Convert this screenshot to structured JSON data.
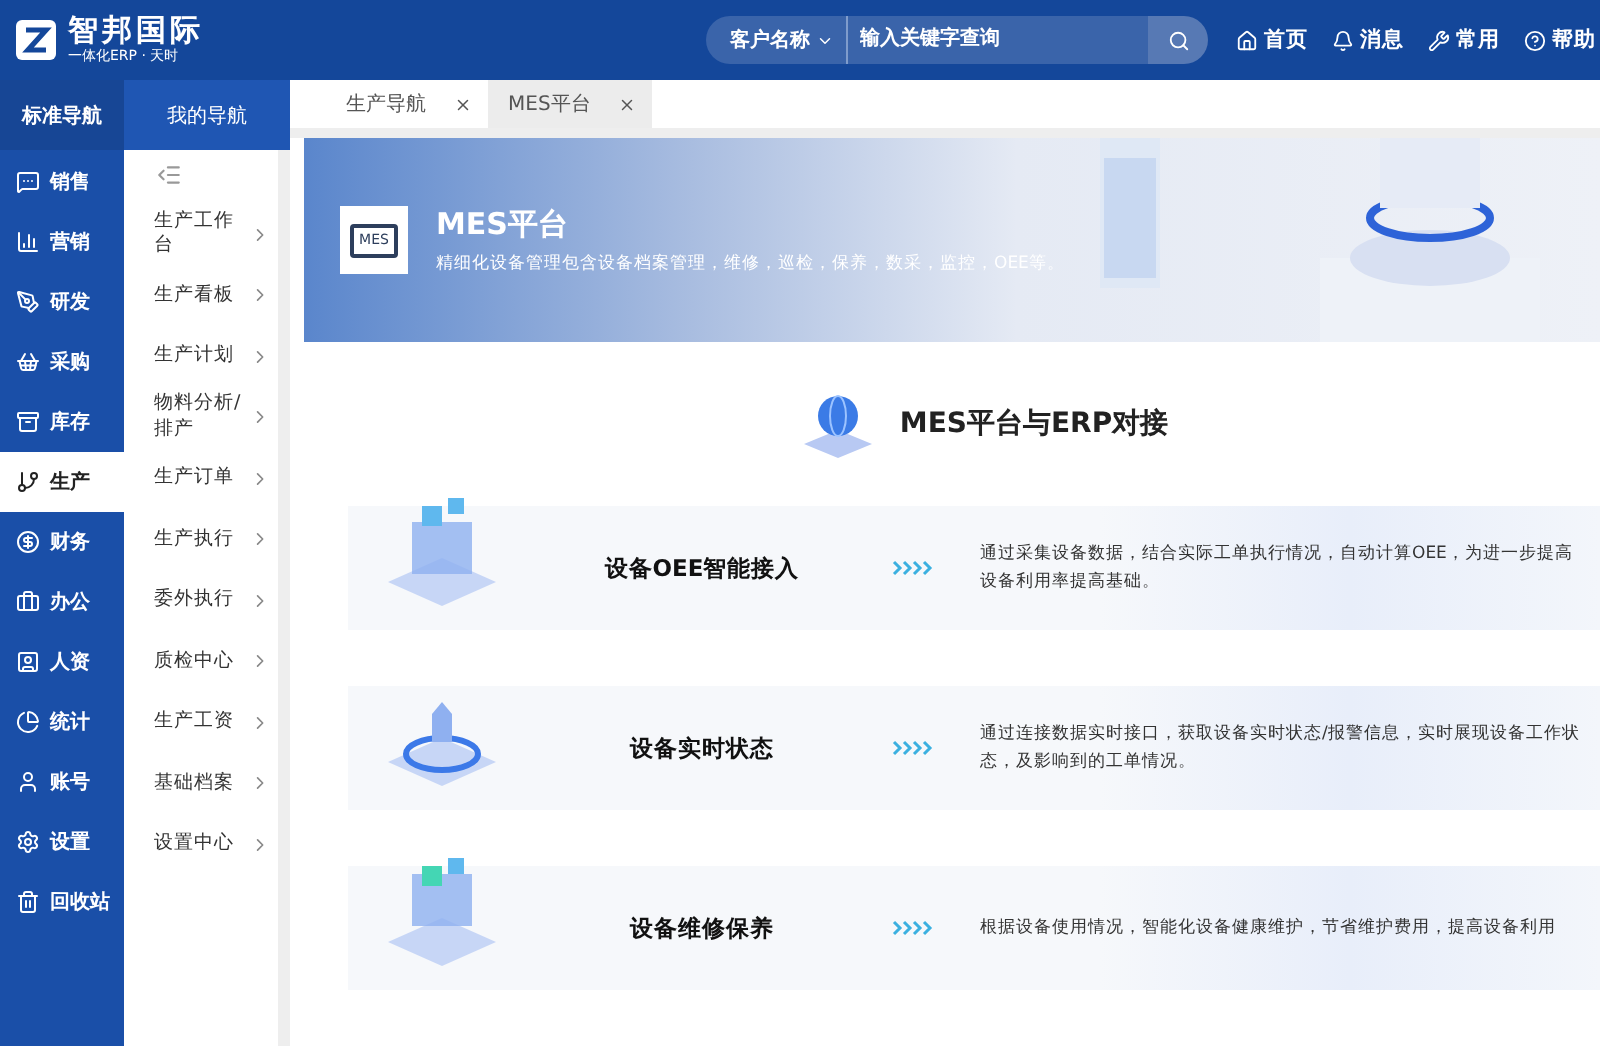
{
  "header": {
    "logo": {
      "name": "智邦国际",
      "slogan": "一体化ERP · 天时"
    },
    "search": {
      "scope": "客户名称",
      "placeholder": "输入关键字查询"
    },
    "links": [
      {
        "label": "首页"
      },
      {
        "label": "消息"
      },
      {
        "label": "常用"
      },
      {
        "label": "帮助"
      }
    ]
  },
  "nav_tabs": [
    {
      "label": "标准导航",
      "selected": true
    },
    {
      "label": "我的导航",
      "selected": false
    }
  ],
  "modules": [
    {
      "label": "销售",
      "selected": false
    },
    {
      "label": "营销",
      "selected": false
    },
    {
      "label": "研发",
      "selected": false
    },
    {
      "label": "采购",
      "selected": false
    },
    {
      "label": "库存",
      "selected": false
    },
    {
      "label": "生产",
      "selected": true
    },
    {
      "label": "财务",
      "selected": false
    },
    {
      "label": "办公",
      "selected": false
    },
    {
      "label": "人资",
      "selected": false
    },
    {
      "label": "统计",
      "selected": false
    },
    {
      "label": "账号",
      "selected": false
    },
    {
      "label": "设置",
      "selected": false
    },
    {
      "label": "回收站",
      "selected": false
    }
  ],
  "submenu": [
    {
      "label": "生产工作台"
    },
    {
      "label": "生产看板"
    },
    {
      "label": "生产计划"
    },
    {
      "label": "物料分析/排产"
    },
    {
      "label": "生产订单"
    },
    {
      "label": "生产执行"
    },
    {
      "label": "委外执行"
    },
    {
      "label": "质检中心"
    },
    {
      "label": "生产工资"
    },
    {
      "label": "基础档案"
    },
    {
      "label": "设置中心"
    }
  ],
  "page_tabs": [
    {
      "label": "生产导航",
      "selected": false
    },
    {
      "label": "MES平台",
      "selected": true
    }
  ],
  "banner": {
    "icon_label": "MES",
    "title": "MES平台",
    "description": "精细化设备管理包含设备档案管理，维修，巡检，保养，数采，监控，OEE等。"
  },
  "section": {
    "title": "MES平台与ERP对接",
    "features": [
      {
        "title": "设备OEE智能接入",
        "description": "通过采集设备数据，结合实际工单执行情况，自动计算OEE，为进一步提高设备利用率提高基础。"
      },
      {
        "title": "设备实时状态",
        "description": "通过连接数据实时接口，获取设备实时状态/报警信息，实时展现设备工作状态，及影响到的工单情况。"
      },
      {
        "title": "设备维修保养",
        "description": "根据设备使用情况，智能化设备健康维护，节省维护费用，提高设备利用"
      }
    ]
  }
}
